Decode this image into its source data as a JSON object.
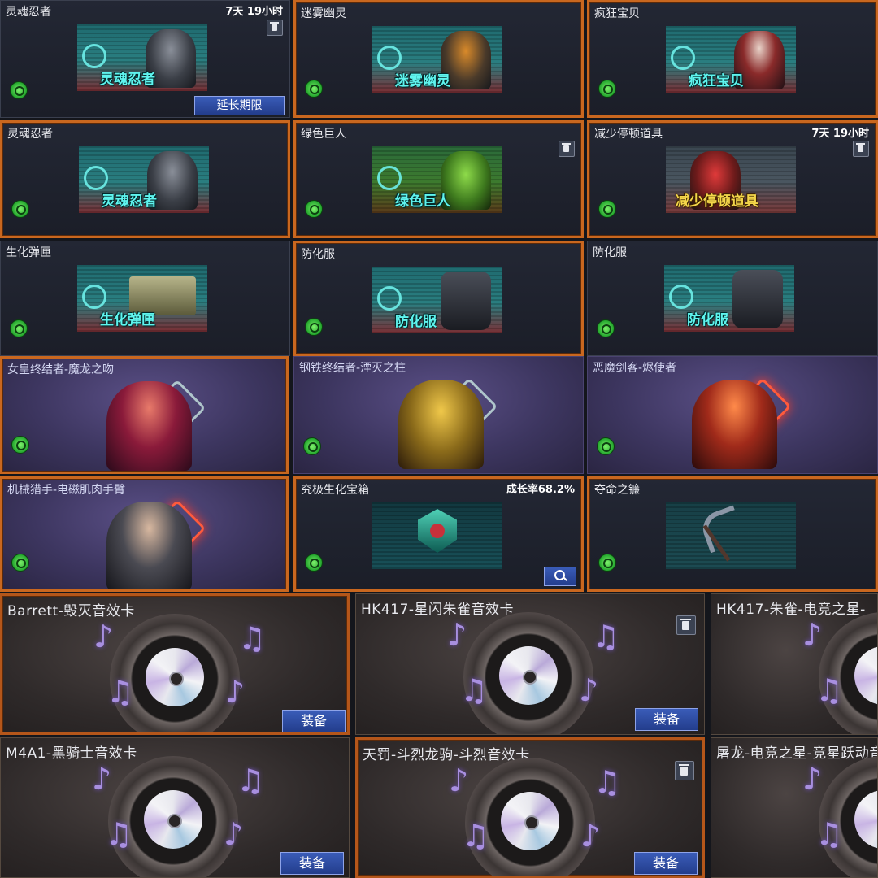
{
  "cards": [
    {
      "title": "灵魂忍者",
      "timer": "7天 19小时",
      "banner": "灵魂忍者",
      "button": "延长期限"
    },
    {
      "title": "迷雾幽灵",
      "banner": "迷雾幽灵"
    },
    {
      "title": "疯狂宝贝",
      "banner": "疯狂宝贝"
    },
    {
      "title": "灵魂忍者",
      "banner": "灵魂忍者"
    },
    {
      "title": "绿色巨人",
      "banner": "绿色巨人"
    },
    {
      "title": "减少停顿道具",
      "timer": "7天 19小时",
      "banner": "减少停顿道具"
    },
    {
      "title": "生化弹匣",
      "banner": "生化弹匣"
    },
    {
      "title": "防化服",
      "banner": "防化服"
    },
    {
      "title": "防化服",
      "banner": "防化服"
    },
    {
      "title": "女皇终结者-魔龙之吻"
    },
    {
      "title": "钢铁终结者-湮灭之柱"
    },
    {
      "title": "恶魔剑客-烬使者"
    },
    {
      "title": "机械猎手-电磁肌肉手臂"
    },
    {
      "title": "究极生化宝箱",
      "timer": "成长率68.2%"
    },
    {
      "title": "夺命之镰"
    }
  ],
  "sound_cards": [
    {
      "title": "Barrett-毁灭音效卡",
      "button": "装备"
    },
    {
      "title": "HK417-星闪朱雀音效卡",
      "button": "装备"
    },
    {
      "title": "HK417-朱雀-电竞之星-"
    },
    {
      "title": "M4A1-黑骑士音效卡",
      "button": "装备"
    },
    {
      "title": "天罚-斗烈龙驹-斗烈音效卡",
      "button": "装备"
    },
    {
      "title": "屠龙-电竞之星-竞星跃动音"
    }
  ],
  "icons": {
    "badge": "biochem-badge-icon",
    "trash": "trash-icon",
    "search": "magnifier-icon",
    "note": "music-note-icon"
  },
  "colors": {
    "gold_border": "#c9671f",
    "button_blue": "#2f4ea6",
    "banner_text": "#5ff4ee"
  }
}
